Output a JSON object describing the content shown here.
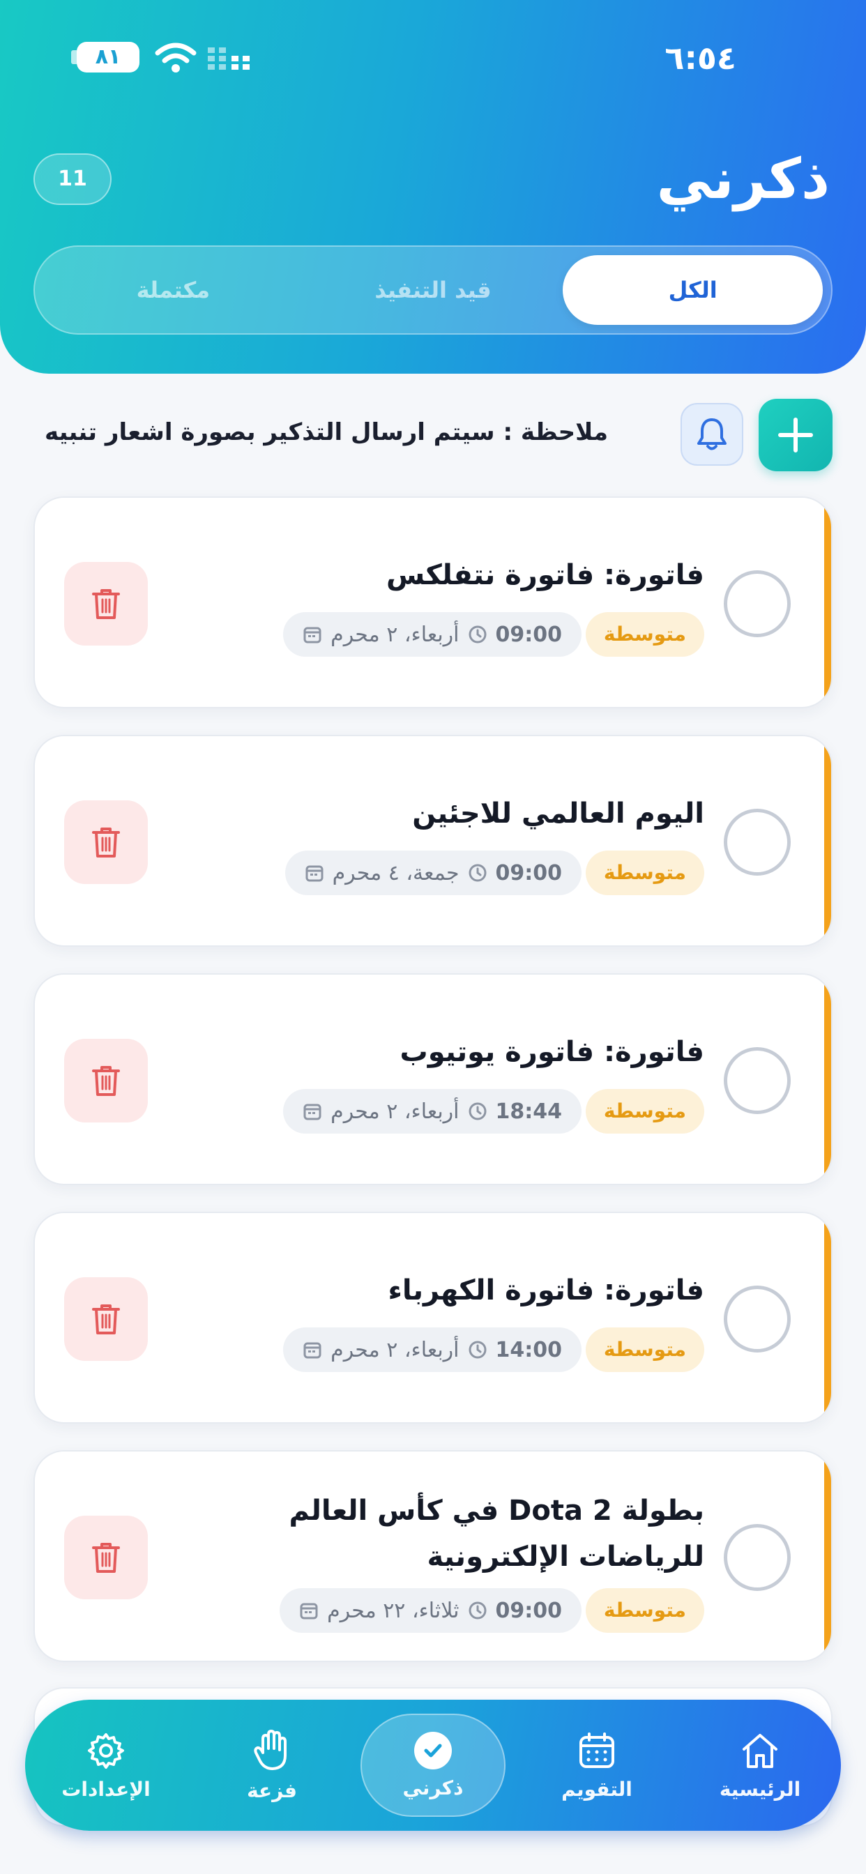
{
  "status_bar": {
    "time": "٦:٥٤",
    "battery": "٨١"
  },
  "header": {
    "title": "ذكرني",
    "count": "11"
  },
  "tabs": [
    {
      "label": "الكل",
      "active": true
    },
    {
      "label": "قيد التنفيذ",
      "active": false
    },
    {
      "label": "مكتملة",
      "active": false
    }
  ],
  "note": {
    "text": "ملاحظة : سيتم ارسال التذكير بصورة اشعار تنبيه"
  },
  "colors": {
    "accent": "#f4a21b",
    "brand_teal": "#18c9c4",
    "brand_blue": "#2a6df0",
    "delete_bg": "#fde8e8",
    "delete_icon": "#e35a5a"
  },
  "reminders": [
    {
      "title": "فاتورة: فاتورة نتفلكس",
      "priority": "متوسطة",
      "date": "أربعاء، ٢ محرم",
      "time": "09:00"
    },
    {
      "title": "اليوم العالمي للاجئين",
      "priority": "متوسطة",
      "date": "جمعة، ٤ محرم",
      "time": "09:00"
    },
    {
      "title": "فاتورة: فاتورة يوتيوب",
      "priority": "متوسطة",
      "date": "أربعاء، ٢ محرم",
      "time": "18:44"
    },
    {
      "title": "فاتورة: فاتورة الكهرباء",
      "priority": "متوسطة",
      "date": "أربعاء، ٢ محرم",
      "time": "14:00"
    },
    {
      "title": "بطولة Dota 2 في كأس العالم للرياضات الإلكترونية",
      "priority": "متوسطة",
      "date": "ثلاثاء، ٢٢ محرم",
      "time": "09:00"
    }
  ],
  "nav": {
    "home": "الرئيسية",
    "calendar": "التقويم",
    "remind": "ذكرني",
    "panic": "فزعة",
    "settings": "الإعدادات"
  }
}
